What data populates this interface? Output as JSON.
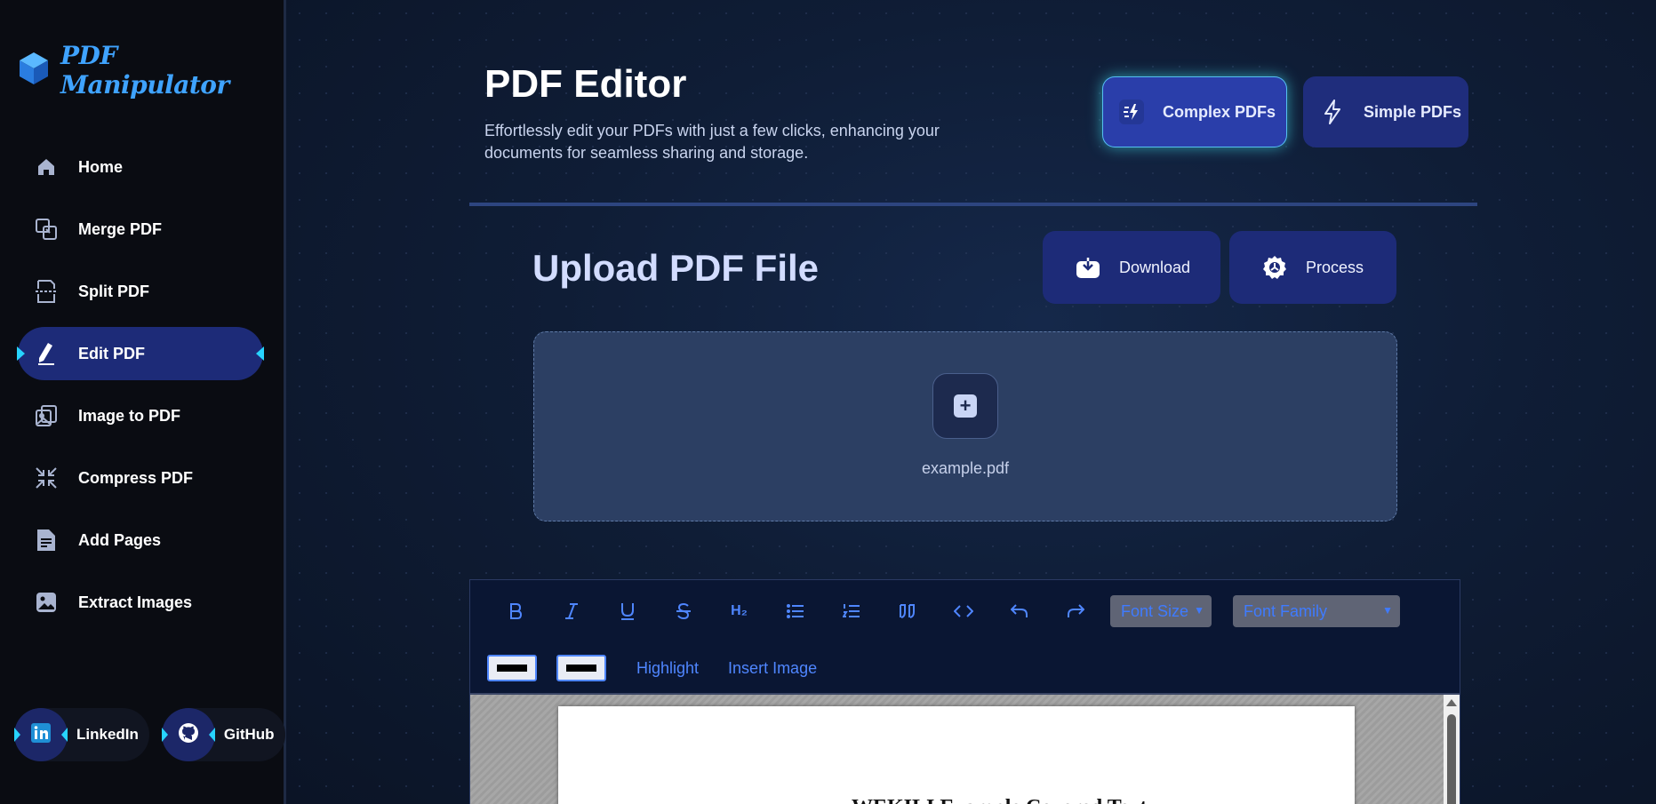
{
  "app": {
    "name": "PDF Manipulator"
  },
  "sidebar": {
    "items": [
      {
        "label": "Home",
        "icon": "home-icon"
      },
      {
        "label": "Merge PDF",
        "icon": "merge-icon"
      },
      {
        "label": "Split PDF",
        "icon": "split-icon"
      },
      {
        "label": "Edit PDF",
        "icon": "edit-icon",
        "active": true
      },
      {
        "label": "Image to PDF",
        "icon": "image-to-pdf-icon"
      },
      {
        "label": "Compress PDF",
        "icon": "compress-icon"
      },
      {
        "label": "Add Pages",
        "icon": "add-pages-icon"
      },
      {
        "label": "Extract Images",
        "icon": "extract-images-icon"
      }
    ],
    "socials": [
      {
        "label": "LinkedIn",
        "icon": "linkedin-icon"
      },
      {
        "label": "GitHub",
        "icon": "github-icon"
      }
    ]
  },
  "header": {
    "title": "PDF Editor",
    "subtitle": "Effortlessly edit your PDFs with just a few clicks, enhancing your documents for seamless sharing and storage.",
    "modes": {
      "complex": "Complex PDFs",
      "simple": "Simple PDFs"
    }
  },
  "upload": {
    "title": "Upload PDF File",
    "download_label": "Download",
    "process_label": "Process",
    "filename": "example.pdf"
  },
  "editor": {
    "toolbar": {
      "heading_label": "H₂",
      "font_size_label": "Font Size",
      "font_family_label": "Font Family",
      "highlight_label": "Highlight",
      "insert_image_label": "Insert Image"
    },
    "page_text": "WEKILI Example Covered Text"
  },
  "colors": {
    "accent": "#27d4ff",
    "active_nav": "#1d2b78",
    "toolbar_icon": "#4f86ff"
  }
}
